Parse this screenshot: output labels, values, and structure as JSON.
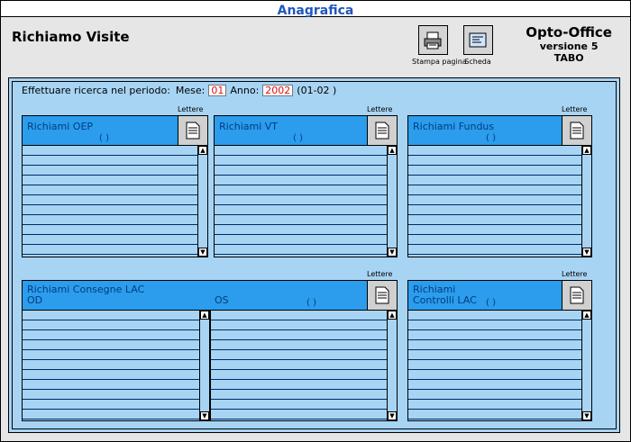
{
  "window": {
    "title": "Anagrafica"
  },
  "page": {
    "heading": "Richiamo Visite"
  },
  "toolbar": {
    "print_label": "Stampa pagina",
    "card_label": "Scheda"
  },
  "brand": {
    "name": "Opto-Office",
    "version": "versione 5",
    "user": "TABO"
  },
  "search": {
    "label": "Effettuare ricerca nel periodo:",
    "month_label": "Mese:",
    "month_value": "01",
    "year_label": "Anno:",
    "year_value": "2002",
    "period": "(01-02 )"
  },
  "panels": {
    "letters_label": "Lettere",
    "oep": {
      "title": "Richiami OEP",
      "count": "(      )"
    },
    "vt": {
      "title": "Richiami VT",
      "count": "(      )"
    },
    "fundus": {
      "title": "Richiami Fundus",
      "count": "(      )"
    },
    "lac_consegne": {
      "title": "Richiami Consegne LAC",
      "od": "OD",
      "os": "OS",
      "count": "(      )"
    },
    "lac_controlli": {
      "title_line1": "Richiami",
      "title_line2": "Controlli LAC",
      "count": "(      )"
    }
  },
  "colors": {
    "accent": "#2c9cec",
    "panel_bg": "#a8d4f4",
    "title": "#1f56c0",
    "field_text": "#e01010"
  },
  "icons": {
    "print": "printer-icon",
    "card": "card-icon",
    "letters": "document-icon",
    "scroll_up": "arrow-up-icon",
    "scroll_down": "arrow-down-icon"
  }
}
